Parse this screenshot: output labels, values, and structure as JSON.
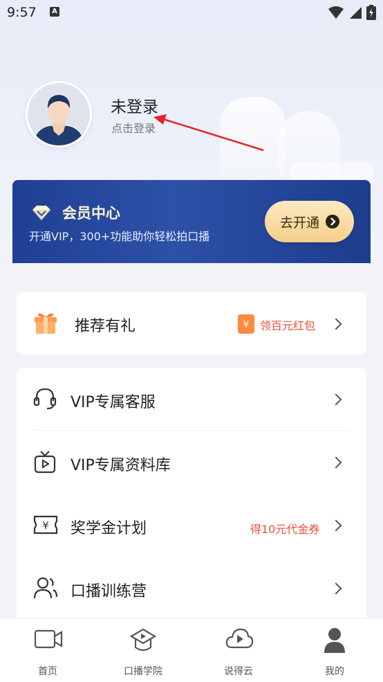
{
  "status_bar": {
    "time": "9:57",
    "notification_glyph": "A"
  },
  "profile": {
    "name": "未登录",
    "subtitle": "点击登录"
  },
  "vip_banner": {
    "title": "会员中心",
    "description": "开通VIP，300+功能助你轻松拍口播",
    "button_label": "去开通",
    "accent": "#2d51a8"
  },
  "referral": {
    "label": "推荐有礼",
    "badge_text": "领百元红包"
  },
  "menu": [
    {
      "label": "VIP专属客服",
      "icon": "headset-icon"
    },
    {
      "label": "VIP专属资料库",
      "icon": "video-library-icon"
    },
    {
      "label": "奖学金计划",
      "icon": "voucher-icon",
      "extra": "得10元代金券"
    },
    {
      "label": "口播训练营",
      "icon": "users-icon"
    }
  ],
  "bottom_nav": [
    {
      "label": "首页",
      "icon": "video-camera-icon",
      "active": false
    },
    {
      "label": "口播学院",
      "icon": "graduation-play-icon",
      "active": false
    },
    {
      "label": "说得云",
      "icon": "cloud-play-icon",
      "active": false
    },
    {
      "label": "我的",
      "icon": "person-icon",
      "active": true
    }
  ],
  "colors": {
    "highlight_red": "#ef4c3a",
    "active_nav": "#555555"
  }
}
